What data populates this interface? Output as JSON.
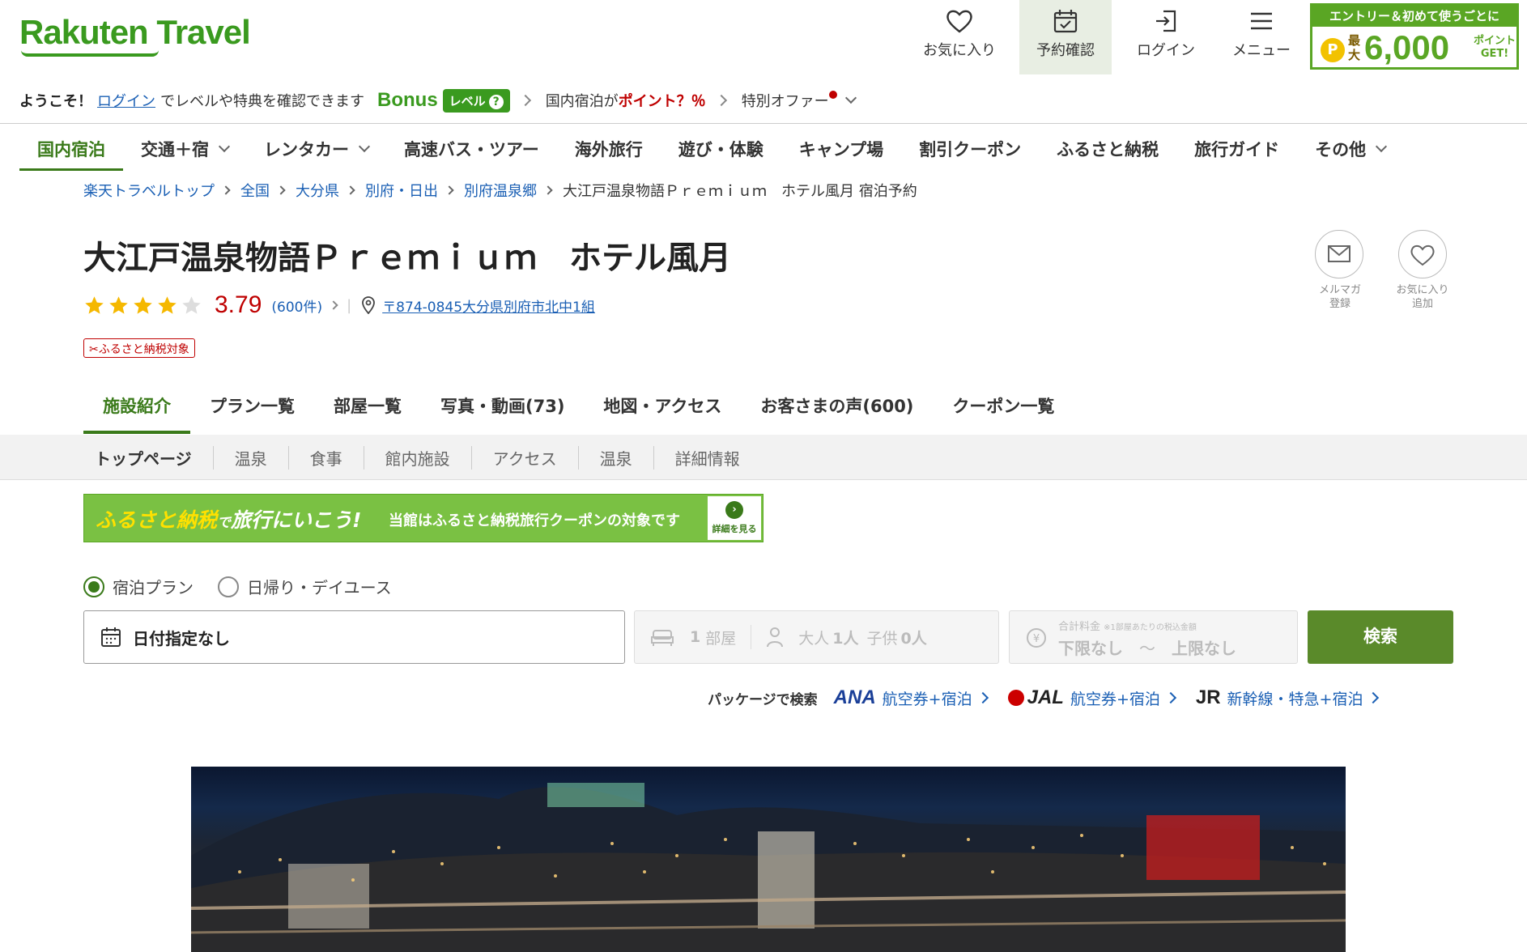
{
  "header": {
    "logo": "Rakuten Travel",
    "nav": {
      "favorites": "お気に入り",
      "booking": "予約確認",
      "login": "ログイン",
      "menu": "メニュー"
    },
    "promo": {
      "top": "エントリー＆初めて使うごとに",
      "coin": "P",
      "max": "最大",
      "amount": "6,000",
      "get": "ポイントGET!"
    },
    "welcome": {
      "greeting": "ようこそ！",
      "login_link": "ログイン",
      "suffix": "でレベルや特典を確認できます",
      "bonus": "Bonus",
      "level": "レベル",
      "level_q": "?",
      "points_prefix": "国内宿泊が",
      "points_highlight": "ポイント？％",
      "special_offer": "特別オファー"
    }
  },
  "category_nav": [
    "国内宿泊",
    "交通＋宿",
    "レンタカー",
    "高速バス・ツアー",
    "海外旅行",
    "遊び・体験",
    "キャンプ場",
    "割引クーポン",
    "ふるさと納税",
    "旅行ガイド",
    "その他"
  ],
  "breadcrumb": [
    "楽天トラベルトップ",
    "全国",
    "大分県",
    "別府・日出",
    "別府温泉郷"
  ],
  "breadcrumb_current": "大江戸温泉物語Ｐｒｅｍｉｕｍ　ホテル風月 宿泊予約",
  "hotel": {
    "name": "大江戸温泉物語Ｐｒｅｍｉｕｍ　ホテル風月",
    "rating": 3.79,
    "rating_text": "3.79",
    "stars_filled": 4,
    "review_count": "(600件)",
    "address": "〒874-0845大分県別府市北中1組",
    "furusato_tag": "ふるさと納税対象",
    "mail_label": "メルマガ\n登録",
    "fav_label": "お気に入り\n追加"
  },
  "facility_tabs": [
    "施設紹介",
    "プラン一覧",
    "部屋一覧",
    "写真・動画(73)",
    "地図・アクセス",
    "お客さまの声(600)",
    "クーポン一覧"
  ],
  "sub_tabs": [
    "トップページ",
    "温泉",
    "食事",
    "館内施設",
    "アクセス",
    "温泉",
    "詳細情報"
  ],
  "furusato_banner": {
    "part1": "ふるさと納税",
    "part2": "で",
    "part3": "旅行にいこう!",
    "small": "当館はふるさと納税旅行クーポンの対象です",
    "detail_arrow": "›",
    "detail": "詳細を見る"
  },
  "search": {
    "plan_type_stay": "宿泊プラン",
    "plan_type_day": "日帰り・デイユース",
    "date": "日付指定なし",
    "rooms": "1",
    "rooms_unit": "部屋",
    "adults_label": "大人",
    "adults": "1人",
    "children_label": "子供",
    "children": "0人",
    "price_caption": "合計料金",
    "price_note": "※1部屋あたりの税込金額",
    "price_min": "下限なし",
    "price_tilde": "～",
    "price_max": "上限なし",
    "button": "検索"
  },
  "package": {
    "label": "パッケージで検索",
    "ana": "ANA",
    "ana_link": "航空券+宿泊",
    "jal": "JAL",
    "jal_link": "航空券+宿泊",
    "jr": "JR",
    "jr_link": "新幹線・特急+宿泊"
  },
  "colors": {
    "brand_green": "#3a9a1f",
    "active_green": "#3a7a1a",
    "accent_red": "#bf0000",
    "link_blue": "#1a5fb4",
    "search_button": "#5a8a2a"
  }
}
